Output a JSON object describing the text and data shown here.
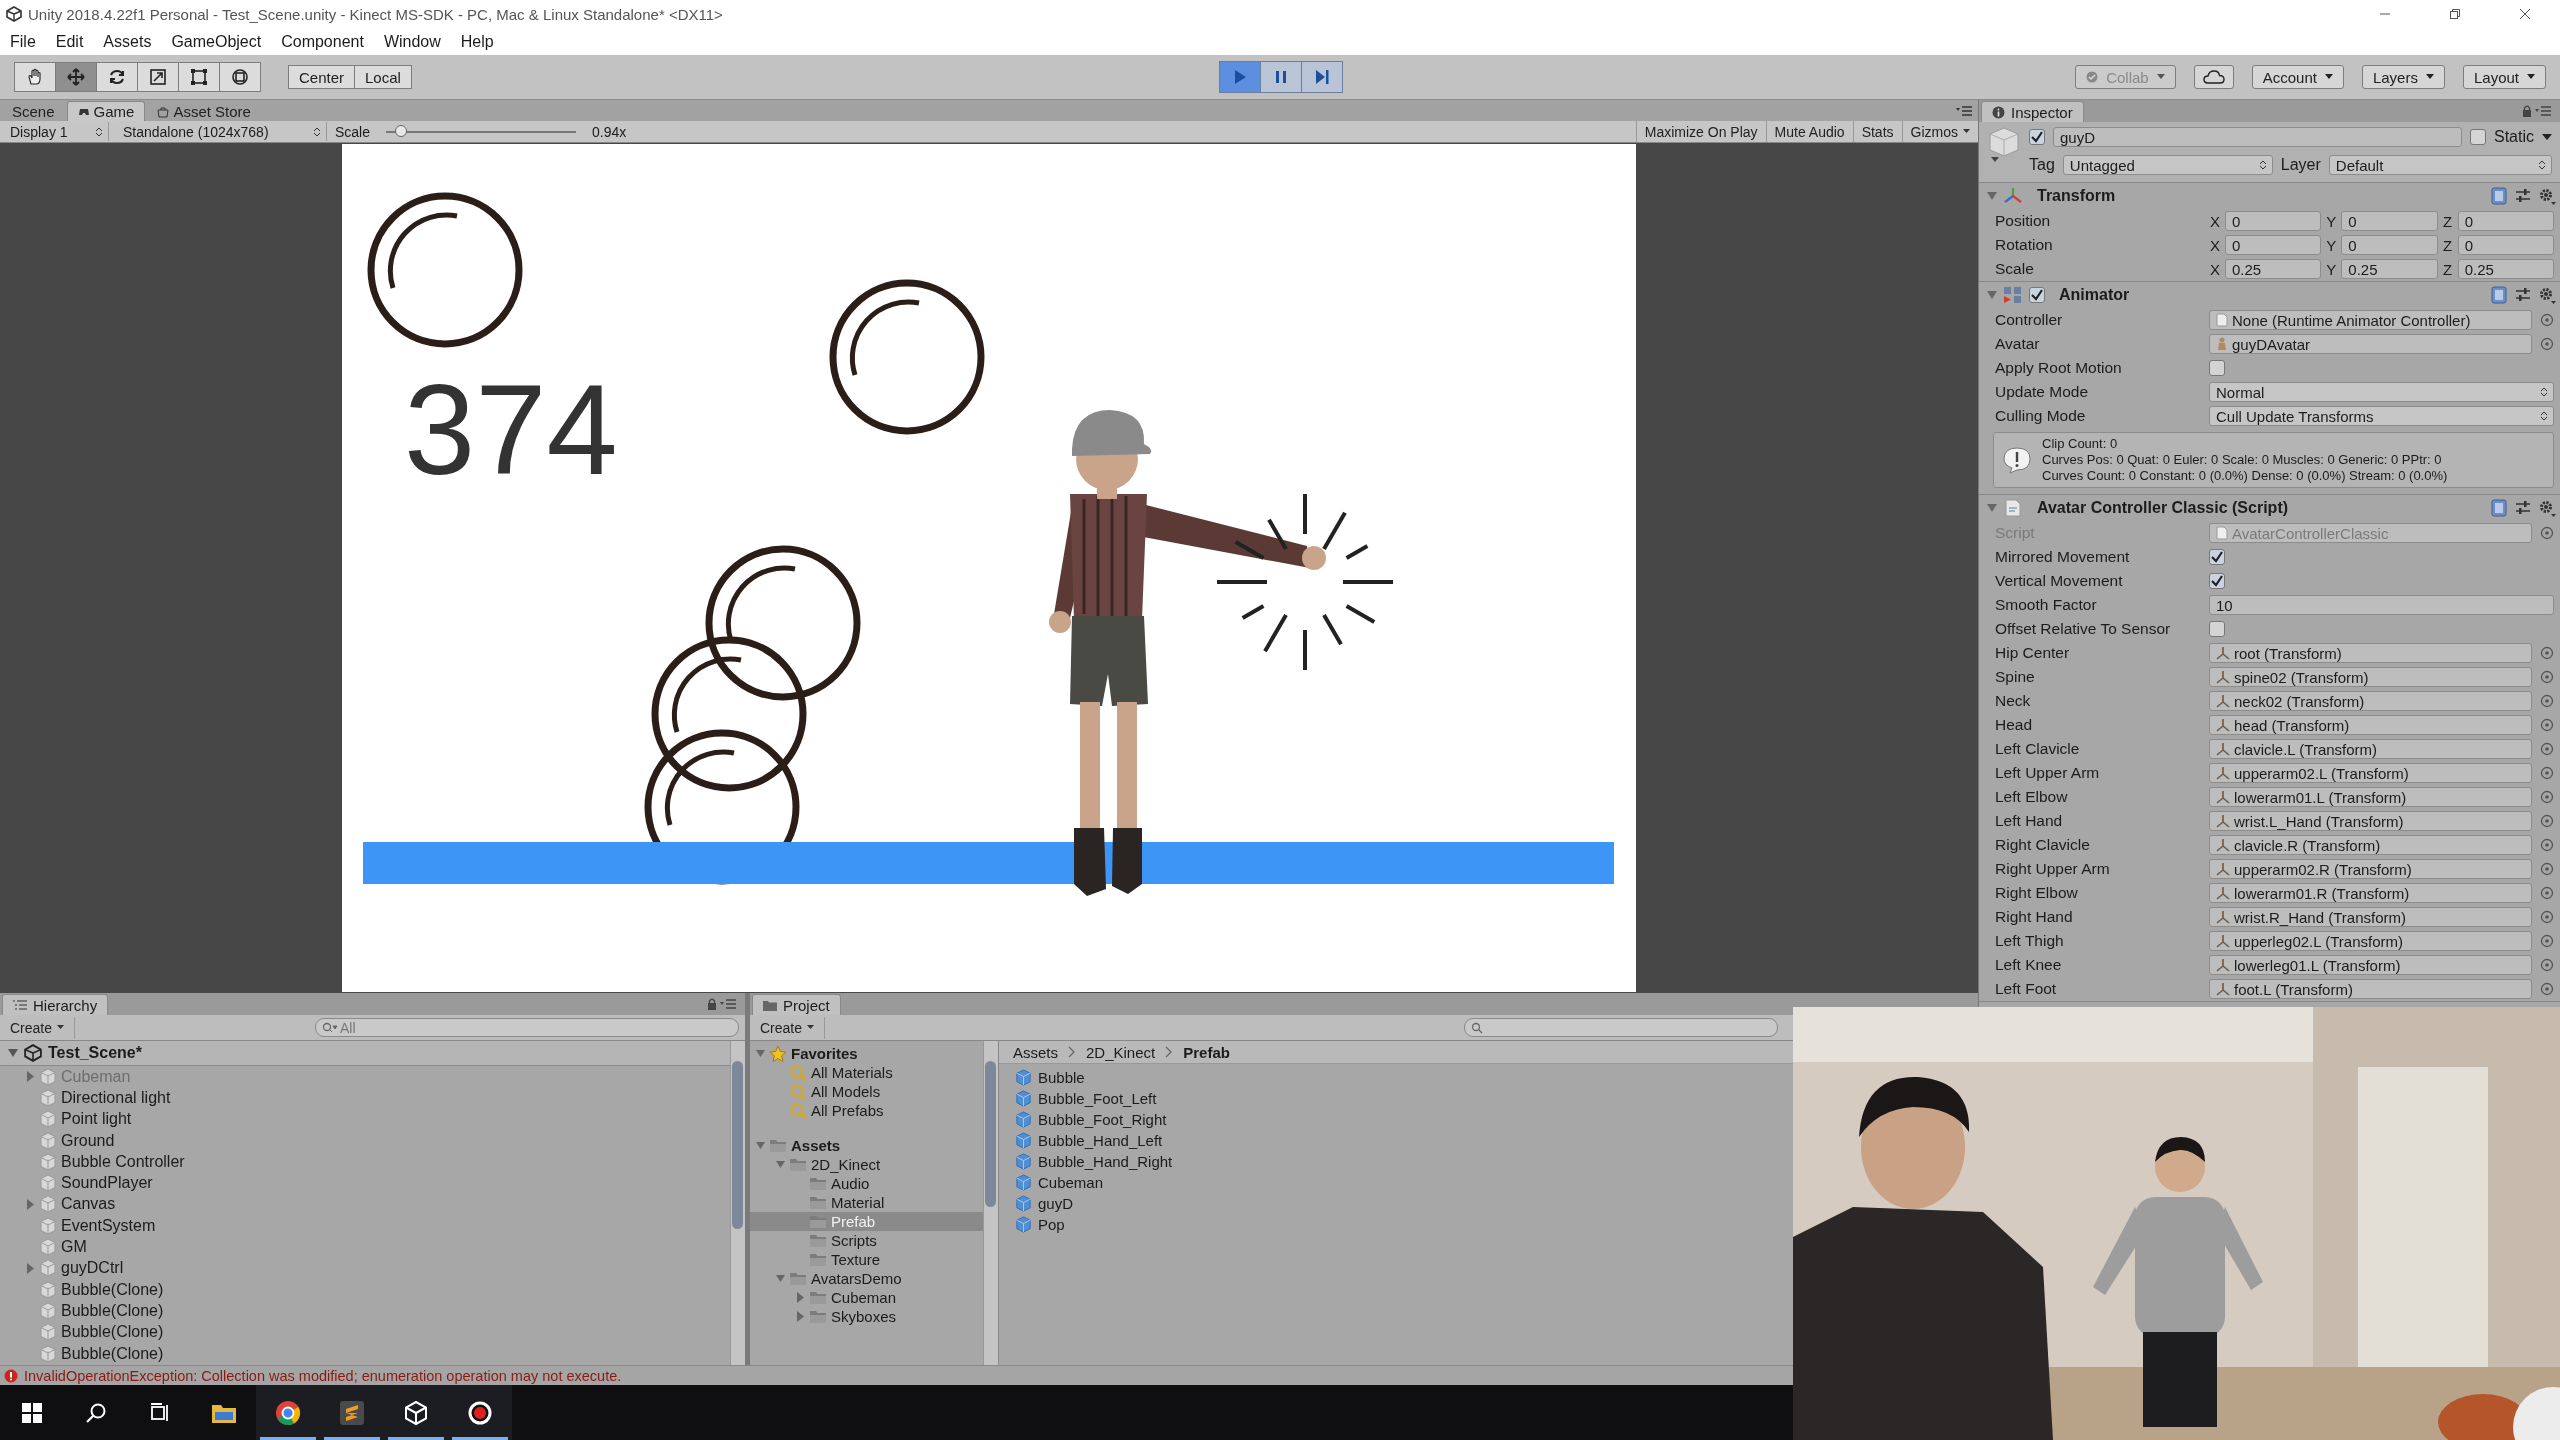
{
  "window": {
    "title": "Unity 2018.4.22f1 Personal - Test_Scene.unity - Kinect MS-SDK - PC, Mac & Linux Standalone* <DX11>"
  },
  "menu": [
    "File",
    "Edit",
    "Assets",
    "GameObject",
    "Component",
    "Window",
    "Help"
  ],
  "tools": [
    {
      "kind": "hand",
      "selected": false
    },
    {
      "kind": "move",
      "selected": true
    },
    {
      "kind": "rotate",
      "selected": false
    },
    {
      "kind": "scale",
      "selected": false
    },
    {
      "kind": "rect",
      "selected": false
    },
    {
      "kind": "transform",
      "selected": false
    }
  ],
  "pivot_buttons": [
    "Center",
    "Local"
  ],
  "playback": {
    "playing": true,
    "paused": false
  },
  "toolbar_right": [
    {
      "kind": "collab",
      "label": "Collab",
      "disabled": true
    },
    {
      "kind": "cloud"
    },
    {
      "kind": "dropdown",
      "label": "Account",
      "disabled": false
    },
    {
      "kind": "dropdown",
      "label": "Layers",
      "disabled": false
    },
    {
      "kind": "dropdown",
      "label": "Layout",
      "disabled": false
    }
  ],
  "view_tabs": [
    {
      "kind": "scene",
      "label": "Scene",
      "selected": false
    },
    {
      "kind": "game",
      "label": "Game",
      "selected": true
    },
    {
      "kind": "store",
      "label": "Asset Store",
      "selected": false
    }
  ],
  "game_bar": {
    "display": "Display 1",
    "resolution": "Standalone (1024x768)",
    "scale_label": "Scale",
    "scale": {
      "level": 0.08
    },
    "scale_value": "0.94x",
    "toggles": [
      "Maximize On Play",
      "Mute Audio",
      "Stats"
    ],
    "gizmos": "Gizmos"
  },
  "game": {
    "score": "374"
  },
  "inspector": {
    "tab": "Inspector",
    "object": {
      "active": true,
      "name": "guyD",
      "static": false,
      "static_label": "Static",
      "tag_label": "Tag",
      "tag": "Untagged",
      "layer_label": "Layer",
      "layer": "Default"
    },
    "components": [
      {
        "kind": "transform",
        "title": "Transform",
        "expanded": true,
        "rows": [
          {
            "label": "Position",
            "cells": [
              {
                "axis": "X",
                "value": "0"
              },
              {
                "axis": "Y",
                "value": "0"
              },
              {
                "axis": "Z",
                "value": "0"
              }
            ]
          },
          {
            "label": "Rotation",
            "cells": [
              {
                "axis": "X",
                "value": "0"
              },
              {
                "axis": "Y",
                "value": "0"
              },
              {
                "axis": "Z",
                "value": "0"
              }
            ]
          },
          {
            "label": "Scale",
            "cells": [
              {
                "axis": "X",
                "value": "0.25"
              },
              {
                "axis": "Y",
                "value": "0.25"
              },
              {
                "axis": "Z",
                "value": "0.25"
              }
            ]
          }
        ]
      },
      {
        "kind": "animator",
        "title": "Animator",
        "expanded": true,
        "enabled": true,
        "fields": [
          {
            "kind": "object",
            "label": "Controller",
            "value": "None (Runtime Animator Controller)"
          },
          {
            "kind": "avatar",
            "label": "Avatar",
            "value": "guyDAvatar"
          },
          {
            "kind": "checkbox",
            "label": "Apply Root Motion",
            "checked": false
          },
          {
            "kind": "dropdown",
            "label": "Update Mode",
            "value": "Normal"
          },
          {
            "kind": "dropdown",
            "label": "Culling Mode",
            "value": "Cull Update Transforms"
          }
        ],
        "info": [
          "Clip Count: 0",
          "Curves Pos: 0 Quat: 0 Euler: 0 Scale: 0 Muscles: 0 Generic: 0 PPtr: 0",
          "Curves Count: 0 Constant: 0 (0.0%) Dense: 0 (0.0%) Stream: 0 (0.0%)"
        ]
      },
      {
        "kind": "script",
        "title": "Avatar Controller Classic (Script)",
        "expanded": true,
        "fields": [
          {
            "kind": "script",
            "label": "Script",
            "value": "AvatarControllerClassic"
          },
          {
            "kind": "checkbox",
            "label": "Mirrored Movement",
            "checked": true
          },
          {
            "kind": "checkbox",
            "label": "Vertical Movement",
            "checked": true
          },
          {
            "kind": "number",
            "label": "Smooth Factor",
            "value": "10"
          },
          {
            "kind": "checkbox",
            "label": "Offset Relative To Sensor",
            "checked": false
          },
          {
            "kind": "transform",
            "label": "Hip Center",
            "value": "root (Transform)"
          },
          {
            "kind": "transform",
            "label": "Spine",
            "value": "spine02 (Transform)"
          },
          {
            "kind": "transform",
            "label": "Neck",
            "value": "neck02 (Transform)"
          },
          {
            "kind": "transform",
            "label": "Head",
            "value": "head (Transform)"
          },
          {
            "kind": "transform",
            "label": "Left Clavicle",
            "value": "clavicle.L (Transform)"
          },
          {
            "kind": "transform",
            "label": "Left Upper Arm",
            "value": "upperarm02.L (Transform)"
          },
          {
            "kind": "transform",
            "label": "Left Elbow",
            "value": "lowerarm01.L (Transform)"
          },
          {
            "kind": "transform",
            "label": "Left Hand",
            "value": "wrist.L_Hand (Transform)"
          },
          {
            "kind": "transform",
            "label": "Right Clavicle",
            "value": "clavicle.R (Transform)"
          },
          {
            "kind": "transform",
            "label": "Right Upper Arm",
            "value": "upperarm02.R (Transform)"
          },
          {
            "kind": "transform",
            "label": "Right Elbow",
            "value": "lowerarm01.R (Transform)"
          },
          {
            "kind": "transform",
            "label": "Right Hand",
            "value": "wrist.R_Hand (Transform)"
          },
          {
            "kind": "transform",
            "label": "Left Thigh",
            "value": "upperleg02.L (Transform)"
          },
          {
            "kind": "transform",
            "label": "Left Knee",
            "value": "lowerleg01.L (Transform)"
          },
          {
            "kind": "transform",
            "label": "Left Foot",
            "value": "foot.L (Transform)"
          }
        ]
      }
    ]
  },
  "hierarchy": {
    "tab": "Hierarchy",
    "create": "Create",
    "search_placeholder": "All",
    "scene": "Test_Scene*",
    "items": [
      {
        "label": "Cubeman",
        "active": false,
        "expanded": false
      },
      {
        "label": "Directional light",
        "active": true
      },
      {
        "label": "Point light",
        "active": true
      },
      {
        "label": "Ground",
        "active": true
      },
      {
        "label": "Bubble Controller",
        "active": true
      },
      {
        "label": "SoundPlayer",
        "active": true
      },
      {
        "label": "Canvas",
        "active": true,
        "expanded": false
      },
      {
        "label": "EventSystem",
        "active": true
      },
      {
        "label": "GM",
        "active": true
      },
      {
        "label": "guyDCtrl",
        "active": true,
        "expanded": false
      },
      {
        "label": "Bubble(Clone)",
        "active": true
      },
      {
        "label": "Bubble(Clone)",
        "active": true
      },
      {
        "label": "Bubble(Clone)",
        "active": true
      },
      {
        "label": "Bubble(Clone)",
        "active": true
      }
    ]
  },
  "project": {
    "tab": "Project",
    "create": "Create",
    "tree": [
      {
        "label": "Favorites",
        "kind": "favorites",
        "expanded": true,
        "selected": false,
        "children": [
          {
            "label": "All Materials",
            "kind": "search",
            "selected": false
          },
          {
            "label": "All Models",
            "kind": "search",
            "selected": false
          },
          {
            "label": "All Prefabs",
            "kind": "search",
            "selected": false
          }
        ]
      },
      {
        "label": "Assets",
        "kind": "folder",
        "expanded": true,
        "selected": false,
        "children": [
          {
            "label": "2D_Kinect",
            "kind": "folder",
            "expanded": true,
            "selected": false,
            "children": [
              {
                "label": "Audio",
                "kind": "folder",
                "selected": false
              },
              {
                "label": "Material",
                "kind": "folder",
                "selected": false
              },
              {
                "label": "Prefab",
                "kind": "folder",
                "selected": true
              },
              {
                "label": "Scripts",
                "kind": "folder",
                "selected": false
              },
              {
                "label": "Texture",
                "kind": "folder",
                "selected": false
              }
            ]
          },
          {
            "label": "AvatarsDemo",
            "kind": "folder",
            "expanded": true,
            "selected": false,
            "children": [
              {
                "label": "Cubeman",
                "kind": "folder",
                "expanded": false,
                "selected": false
              },
              {
                "label": "Skyboxes",
                "kind": "folder",
                "expanded": false,
                "selected": false
              }
            ]
          }
        ]
      }
    ],
    "breadcrumb": [
      "Assets",
      "2D_Kinect",
      "Prefab"
    ],
    "files": [
      "Bubble",
      "Bubble_Foot_Left",
      "Bubble_Foot_Right",
      "Bubble_Hand_Left",
      "Bubble_Hand_Right",
      "Cubeman",
      "guyD",
      "Pop"
    ]
  },
  "status": {
    "error": "InvalidOperationException: Collection was modified; enumeration operation may not execute."
  },
  "taskbar": [
    {
      "kind": "start",
      "running": false
    },
    {
      "kind": "search",
      "running": false
    },
    {
      "kind": "taskview",
      "running": false
    },
    {
      "kind": "explorer",
      "running": false
    },
    {
      "kind": "browser",
      "running": true
    },
    {
      "kind": "editor",
      "running": true
    },
    {
      "kind": "unity",
      "running": true
    },
    {
      "kind": "recorder",
      "running": true
    }
  ],
  "webcam": {
    "kind": "picture"
  }
}
